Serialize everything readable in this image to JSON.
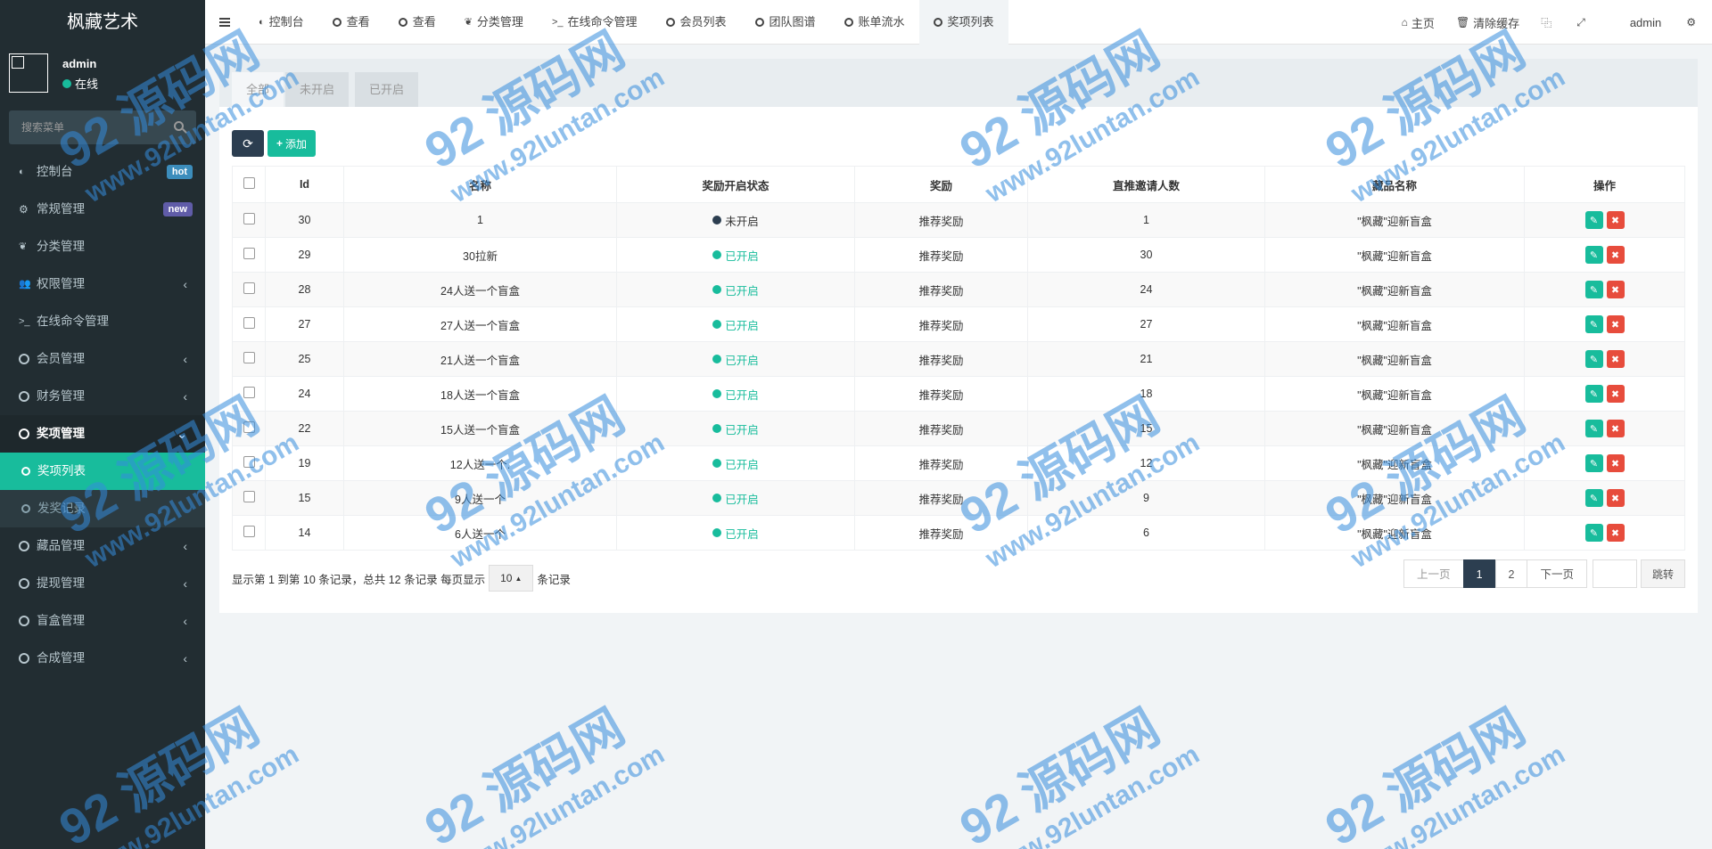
{
  "sidebar": {
    "brand": "枫藏艺术",
    "user_name": "admin",
    "user_status": "在线",
    "search_placeholder": "搜索菜单",
    "items": [
      {
        "label": "控制台",
        "badge": "hot"
      },
      {
        "label": "常规管理",
        "badge": "new"
      },
      {
        "label": "分类管理"
      },
      {
        "label": "权限管理"
      },
      {
        "label": "在线命令管理"
      },
      {
        "label": "会员管理"
      },
      {
        "label": "财务管理"
      },
      {
        "label": "奖项管理"
      },
      {
        "label": "奖项列表"
      },
      {
        "label": "发奖记录"
      },
      {
        "label": "藏品管理"
      },
      {
        "label": "提现管理"
      },
      {
        "label": "盲盒管理"
      },
      {
        "label": "合成管理"
      }
    ]
  },
  "topbar": {
    "tabs": [
      "控制台",
      "查看",
      "查看",
      "分类管理",
      "在线命令管理",
      "会员列表",
      "团队图谱",
      "账单流水",
      "奖项列表"
    ],
    "home": "主页",
    "clear_cache": "清除缓存",
    "user": "admin"
  },
  "panel": {
    "tabs": [
      "全部",
      "未开启",
      "已开启"
    ],
    "add_label": "添加",
    "columns": [
      "Id",
      "名称",
      "奖励开启状态",
      "奖励",
      "直推邀请人数",
      "藏品名称",
      "操作"
    ],
    "rows": [
      {
        "id": "30",
        "name": "1",
        "status": "未开启",
        "on": false,
        "reward": "推荐奖励",
        "count": "1",
        "item": "\"枫藏\"迎新盲盒"
      },
      {
        "id": "29",
        "name": "30拉新",
        "status": "已开启",
        "on": true,
        "reward": "推荐奖励",
        "count": "30",
        "item": "\"枫藏\"迎新盲盒"
      },
      {
        "id": "28",
        "name": "24人送一个盲盒",
        "status": "已开启",
        "on": true,
        "reward": "推荐奖励",
        "count": "24",
        "item": "\"枫藏\"迎新盲盒"
      },
      {
        "id": "27",
        "name": "27人送一个盲盒",
        "status": "已开启",
        "on": true,
        "reward": "推荐奖励",
        "count": "27",
        "item": "\"枫藏\"迎新盲盒"
      },
      {
        "id": "25",
        "name": "21人送一个盲盒",
        "status": "已开启",
        "on": true,
        "reward": "推荐奖励",
        "count": "21",
        "item": "\"枫藏\"迎新盲盒"
      },
      {
        "id": "24",
        "name": "18人送一个盲盒",
        "status": "已开启",
        "on": true,
        "reward": "推荐奖励",
        "count": "18",
        "item": "\"枫藏\"迎新盲盒"
      },
      {
        "id": "22",
        "name": "15人送一个盲盒",
        "status": "已开启",
        "on": true,
        "reward": "推荐奖励",
        "count": "15",
        "item": "\"枫藏\"迎新盲盒"
      },
      {
        "id": "19",
        "name": "12人送一个.",
        "status": "已开启",
        "on": true,
        "reward": "推荐奖励",
        "count": "12",
        "item": "\"枫藏\"迎新盲盒"
      },
      {
        "id": "15",
        "name": "9人送一个",
        "status": "已开启",
        "on": true,
        "reward": "推荐奖励",
        "count": "9",
        "item": "\"枫藏\"迎新盲盒"
      },
      {
        "id": "14",
        "name": "6人送一个",
        "status": "已开启",
        "on": true,
        "reward": "推荐奖励",
        "count": "6",
        "item": "\"枫藏\"迎新盲盒"
      }
    ],
    "footer_text": "显示第 1 到第 10 条记录，总共 12 条记录 每页显示",
    "page_size": "10",
    "footer_suffix": "条记录",
    "pager": {
      "prev": "上一页",
      "pages": [
        "1",
        "2"
      ],
      "next": "下一页",
      "jump": "跳转"
    }
  },
  "watermark": {
    "big": "92 源码网",
    "small": "www.92luntan.com"
  },
  "colors": {
    "accent": "#18bc9c",
    "sidebar": "#222d32",
    "danger": "#e74c3c",
    "dark": "#2c3e50"
  }
}
